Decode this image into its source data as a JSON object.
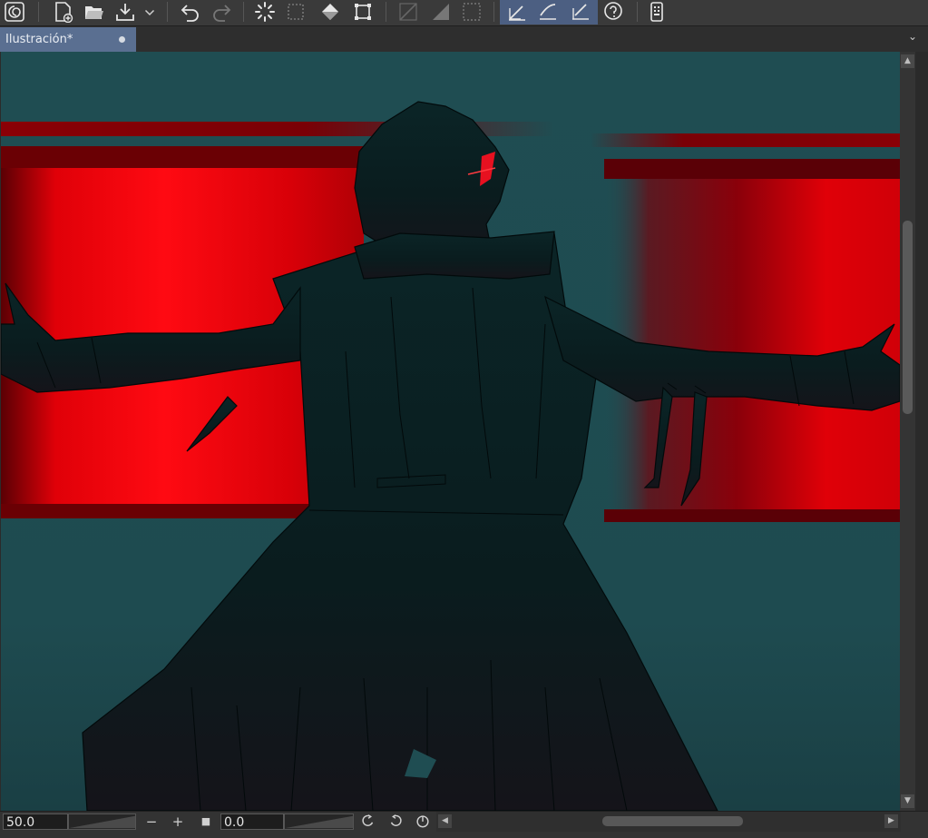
{
  "toolbar": {
    "tools": [
      {
        "name": "clip-studio-logo-icon"
      },
      {
        "name": "new-file-icon"
      },
      {
        "name": "open-folder-icon"
      },
      {
        "name": "export-icon"
      },
      {
        "name": "dropdown-chevron-icon"
      },
      {
        "name": "undo-icon"
      },
      {
        "name": "redo-icon"
      },
      {
        "name": "loading-spinner-icon"
      },
      {
        "name": "selection-icon"
      },
      {
        "name": "fill-icon"
      },
      {
        "name": "transform-icon"
      },
      {
        "name": "ruler-icon"
      },
      {
        "name": "gradient-icon"
      },
      {
        "name": "frame-icon"
      },
      {
        "name": "pen-edit-icon"
      },
      {
        "name": "brush-edit-icon"
      },
      {
        "name": "eraser-edit-icon"
      },
      {
        "name": "help-icon"
      },
      {
        "name": "device-icon"
      }
    ]
  },
  "tab": {
    "label": "Ilustración*"
  },
  "status": {
    "zoom_value": "50.0",
    "rotation_value": "0.0",
    "zoom_out_label": "−",
    "zoom_in_label": "+",
    "fit_label": "■"
  },
  "colors": {
    "canvas_bg": "#1f4d52",
    "accent_red": "#e00008",
    "silhouette": "#0d2426",
    "tab_active": "#5a6f91",
    "toolbar_active": "#4c5f82"
  }
}
